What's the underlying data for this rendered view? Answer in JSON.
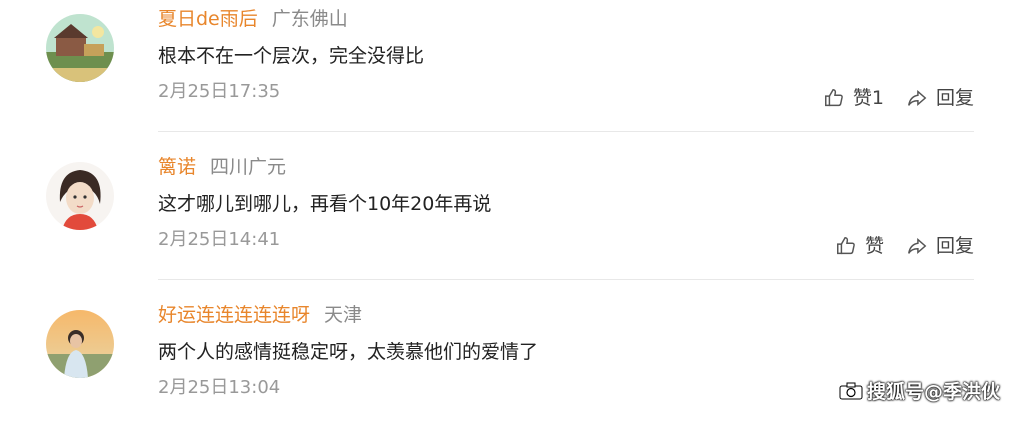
{
  "comments": [
    {
      "username": "夏日de雨后",
      "location": "广东佛山",
      "text": "根本不在一个层次，完全没得比",
      "time": "2月25日17:35",
      "like_label": "赞1",
      "reply_label": "回复"
    },
    {
      "username": "篱诺",
      "location": "四川广元",
      "text": "这才哪儿到哪儿，再看个10年20年再说",
      "time": "2月25日14:41",
      "like_label": "赞",
      "reply_label": "回复"
    },
    {
      "username": "好运连连连连连呀",
      "location": "天津",
      "text": "两个人的感情挺稳定呀，太羡慕他们的爱情了",
      "time": "2月25日13:04"
    }
  ],
  "watermark": {
    "text": "搜狐号@季洪伙"
  },
  "icons": {
    "like": "thumbs-up-icon",
    "reply": "share-arrow-icon",
    "watermark": "camera-icon"
  },
  "colors": {
    "username": "#e8862c",
    "location": "#8a8a8a",
    "time": "#999999",
    "text": "#222222"
  }
}
